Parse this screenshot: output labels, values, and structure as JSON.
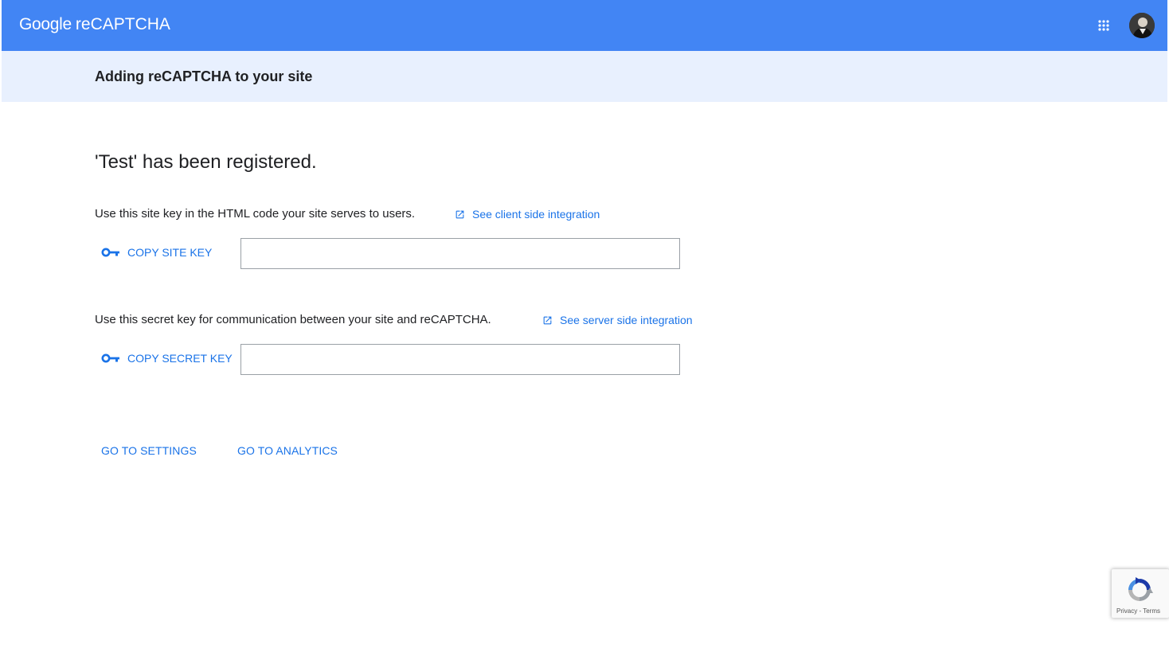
{
  "header": {
    "brand_google": "Google",
    "brand_product": "reCAPTCHA",
    "apps_icon": "apps-grid-icon",
    "avatar_icon": "account-avatar-icon",
    "color": "#4285f4"
  },
  "subheader": {
    "title": "Adding reCAPTCHA to your site",
    "color": "#e8f0fe"
  },
  "main": {
    "registered_title": "'Test' has been registered.",
    "site_key": {
      "description": "Use this site key in the HTML code your site serves to users.",
      "link_label": "See client side integration",
      "link_icon": "open-in-new-icon",
      "copy_label": "COPY SITE KEY",
      "copy_icon": "key-icon",
      "value": ""
    },
    "secret_key": {
      "description": "Use this secret key for communication between your site and reCAPTCHA.",
      "link_label": "See server side integration",
      "link_icon": "open-in-new-icon",
      "copy_label": "COPY SECRET KEY",
      "copy_icon": "key-icon",
      "value": ""
    },
    "actions": {
      "settings_label": "GO TO SETTINGS",
      "analytics_label": "GO TO ANALYTICS"
    },
    "link_color": "#1a73e8"
  },
  "recaptcha_badge": {
    "logo_icon": "recaptcha-logo-icon",
    "privacy_label": "Privacy",
    "separator": " - ",
    "terms_label": "Terms"
  }
}
